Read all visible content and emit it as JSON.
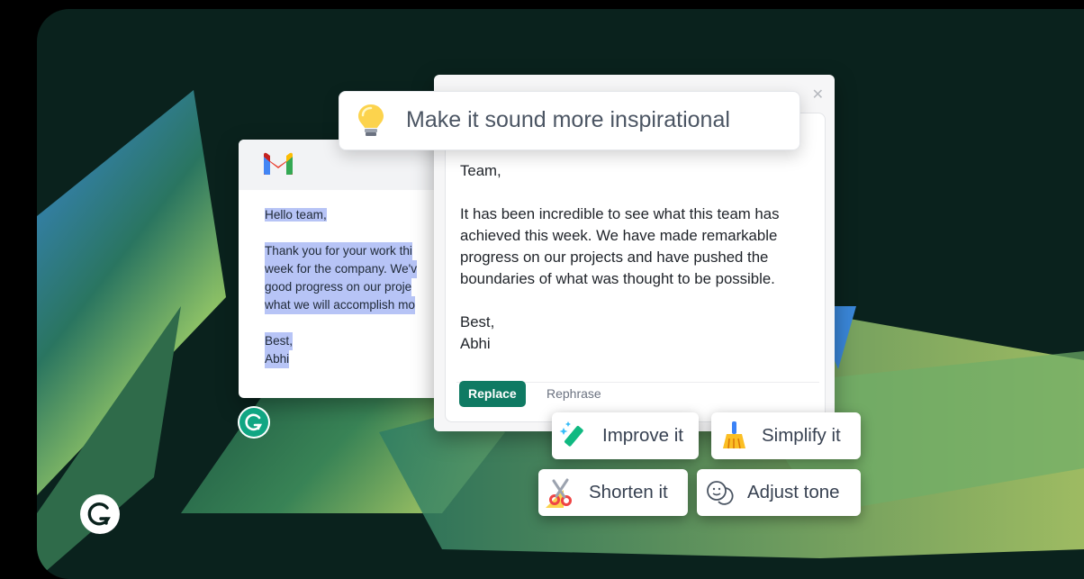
{
  "gmail": {
    "logo": "gmail-logo",
    "lines": {
      "greeting": "Hello team,",
      "body1": "Thank you for your work thi",
      "body2": "week for the company. We'v",
      "body3": "good progress on our proje",
      "body4": "what we will accomplish mo",
      "signoff": "Best,",
      "name": "Abhi"
    }
  },
  "prompt": {
    "icon": "lightbulb-icon",
    "text": "Make it sound more inspirational"
  },
  "panel": {
    "close_icon": "close-icon",
    "greeting": "Team,",
    "body": "It has been incredible to see what this team has achieved this week. We have made remarkable progress on our projects and have pushed the boundaries of what was thought to be possible.",
    "signoff": "Best,",
    "name": "Abhi",
    "replace_label": "Replace",
    "rephrase_label": "Rephrase"
  },
  "actions": {
    "improve": "Improve it",
    "simplify": "Simplify it",
    "shorten": "Shorten it",
    "adjust": "Adjust tone"
  },
  "colors": {
    "accent": "#0f7a63",
    "highlight": "#b7c4f6",
    "background": "#0a221d"
  }
}
